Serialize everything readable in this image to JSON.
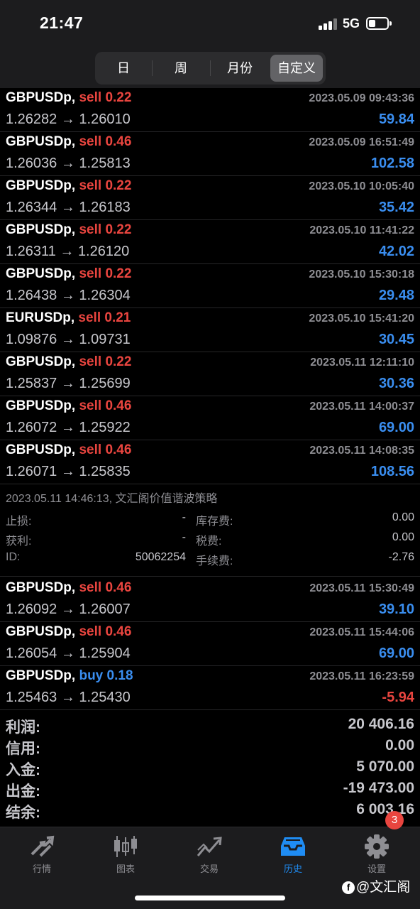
{
  "status_bar": {
    "time": "21:47",
    "network": "5G"
  },
  "period_tabs": [
    {
      "label": "日",
      "active": false
    },
    {
      "label": "周",
      "active": false
    },
    {
      "label": "月份",
      "active": false
    },
    {
      "label": "自定义",
      "active": true
    }
  ],
  "deals": [
    {
      "symbol": "GBPUSDp,",
      "side": "sell",
      "volume": "0.22",
      "datetime": "2023.05.09 09:43:36",
      "open": "1.26282",
      "close": "1.26010",
      "profit": "59.84"
    },
    {
      "symbol": "GBPUSDp,",
      "side": "sell",
      "volume": "0.46",
      "datetime": "2023.05.09 16:51:49",
      "open": "1.26036",
      "close": "1.25813",
      "profit": "102.58"
    },
    {
      "symbol": "GBPUSDp,",
      "side": "sell",
      "volume": "0.22",
      "datetime": "2023.05.10 10:05:40",
      "open": "1.26344",
      "close": "1.26183",
      "profit": "35.42"
    },
    {
      "symbol": "GBPUSDp,",
      "side": "sell",
      "volume": "0.22",
      "datetime": "2023.05.10 11:41:22",
      "open": "1.26311",
      "close": "1.26120",
      "profit": "42.02"
    },
    {
      "symbol": "GBPUSDp,",
      "side": "sell",
      "volume": "0.22",
      "datetime": "2023.05.10 15:30:18",
      "open": "1.26438",
      "close": "1.26304",
      "profit": "29.48"
    },
    {
      "symbol": "EURUSDp,",
      "side": "sell",
      "volume": "0.21",
      "datetime": "2023.05.10 15:41:20",
      "open": "1.09876",
      "close": "1.09731",
      "profit": "30.45"
    },
    {
      "symbol": "GBPUSDp,",
      "side": "sell",
      "volume": "0.22",
      "datetime": "2023.05.11 12:11:10",
      "open": "1.25837",
      "close": "1.25699",
      "profit": "30.36"
    },
    {
      "symbol": "GBPUSDp,",
      "side": "sell",
      "volume": "0.46",
      "datetime": "2023.05.11 14:00:37",
      "open": "1.26072",
      "close": "1.25922",
      "profit": "69.00"
    },
    {
      "symbol": "GBPUSDp,",
      "side": "sell",
      "volume": "0.46",
      "datetime": "2023.05.11 14:08:35",
      "open": "1.26071",
      "close": "1.25835",
      "profit": "108.56"
    },
    {
      "symbol": "GBPUSDp,",
      "side": "sell",
      "volume": "0.46",
      "datetime": "2023.05.11 15:30:49",
      "open": "1.26092",
      "close": "1.26007",
      "profit": "39.10"
    },
    {
      "symbol": "GBPUSDp,",
      "side": "sell",
      "volume": "0.46",
      "datetime": "2023.05.11 15:44:06",
      "open": "1.26054",
      "close": "1.25904",
      "profit": "69.00"
    },
    {
      "symbol": "GBPUSDp,",
      "side": "buy",
      "volume": "0.18",
      "datetime": "2023.05.11 16:23:59",
      "open": "1.25463",
      "close": "1.25430",
      "profit": "-5.94"
    }
  ],
  "arrow": "→",
  "detail": {
    "comment": "2023.05.11 14:46:13, 文汇阁价值谐波策略",
    "stop_loss_label": "止损:",
    "stop_loss": "-",
    "swap_label": "库存费:",
    "swap": "0.00",
    "take_profit_label": "获利:",
    "take_profit": "-",
    "taxes_label": "税费:",
    "taxes": "0.00",
    "id_label": "ID:",
    "id": "50062254",
    "commission_label": "手续费:",
    "commission": "-2.76"
  },
  "summary": [
    {
      "label": "利润:",
      "value": "20 406.16"
    },
    {
      "label": "信用:",
      "value": "0.00"
    },
    {
      "label": "入金:",
      "value": "5 070.00"
    },
    {
      "label": "出金:",
      "value": "-19 473.00"
    },
    {
      "label": "结余:",
      "value": "6 003.16"
    }
  ],
  "tabbar": [
    {
      "label": "行情",
      "icon": "quotes-arrows-icon",
      "active": false
    },
    {
      "label": "图表",
      "icon": "candlestick-chart-icon",
      "active": false
    },
    {
      "label": "交易",
      "icon": "trade-trend-icon",
      "active": false
    },
    {
      "label": "历史",
      "icon": "history-inbox-icon",
      "active": true
    },
    {
      "label": "设置",
      "icon": "gear-icon",
      "active": false
    }
  ],
  "settings_badge": "3",
  "watermark": "@文汇阁",
  "colors": {
    "sell": "#e9453f",
    "buy": "#3a8ef0",
    "active_tab": "#1f8cf3"
  }
}
